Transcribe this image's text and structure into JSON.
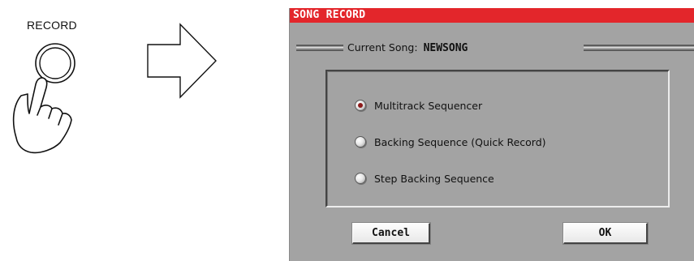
{
  "illustration": {
    "record_label": "RECORD",
    "button_icon": "record-button-icon",
    "hand_icon": "pointing-hand-icon",
    "arrow_icon": "right-arrow-icon"
  },
  "dialog": {
    "title": "SONG RECORD",
    "title_color": "#e3262b",
    "current_song_label": "Current Song:",
    "current_song_name": "NEWSONG",
    "options": [
      {
        "label": "Multitrack Sequencer",
        "selected": true
      },
      {
        "label": "Backing Sequence (Quick Record)",
        "selected": false
      },
      {
        "label": "Step Backing Sequence",
        "selected": false
      }
    ],
    "cancel_label": "Cancel",
    "ok_label": "OK"
  }
}
